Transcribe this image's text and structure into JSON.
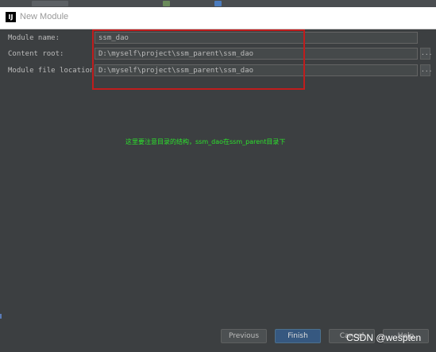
{
  "window": {
    "title": "New Module",
    "app_icon": "intellij-icon"
  },
  "form": {
    "module_name": {
      "label": "Module name:",
      "value": "ssm_dao"
    },
    "content_root": {
      "label": "Content root:",
      "value": "D:\\myself\\project\\ssm_parent\\ssm_dao"
    },
    "module_file_location": {
      "label": "Module file location:",
      "value": "D:\\myself\\project\\ssm_parent\\ssm_dao"
    },
    "browse_label": "..."
  },
  "annotation": {
    "text": "这里要注意目录的结构，ssm_dao在ssm_parent目录下",
    "color": "#2be32b",
    "box_color": "#c01d1d"
  },
  "buttons": {
    "previous": "Previous",
    "finish": "Finish",
    "cancel": "Cancel",
    "help": "Help"
  },
  "watermark": "CSDN @wespten",
  "colors": {
    "background": "#3c3f41",
    "primary_button": "#365880"
  }
}
